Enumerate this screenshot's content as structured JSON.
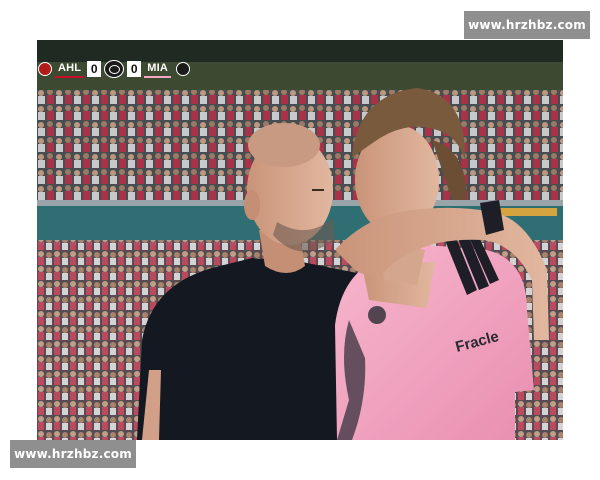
{
  "watermark": {
    "top_text": "www.hrzhbz.com",
    "bottom_text": "www.hrzhbz.com"
  },
  "scoreboard": {
    "home_team": "AHL",
    "home_score": "0",
    "away_team": "MIA",
    "away_score": "0",
    "icons": [
      "home-crest-icon",
      "league-logo-icon",
      "away-crest-icon"
    ]
  },
  "photo": {
    "jersey_sponsor": "Fracle",
    "colors": {
      "jersey_pink": "#f4a7c2",
      "shirt_dark": "#141821",
      "pitch_wall": "#2f6f73"
    }
  }
}
